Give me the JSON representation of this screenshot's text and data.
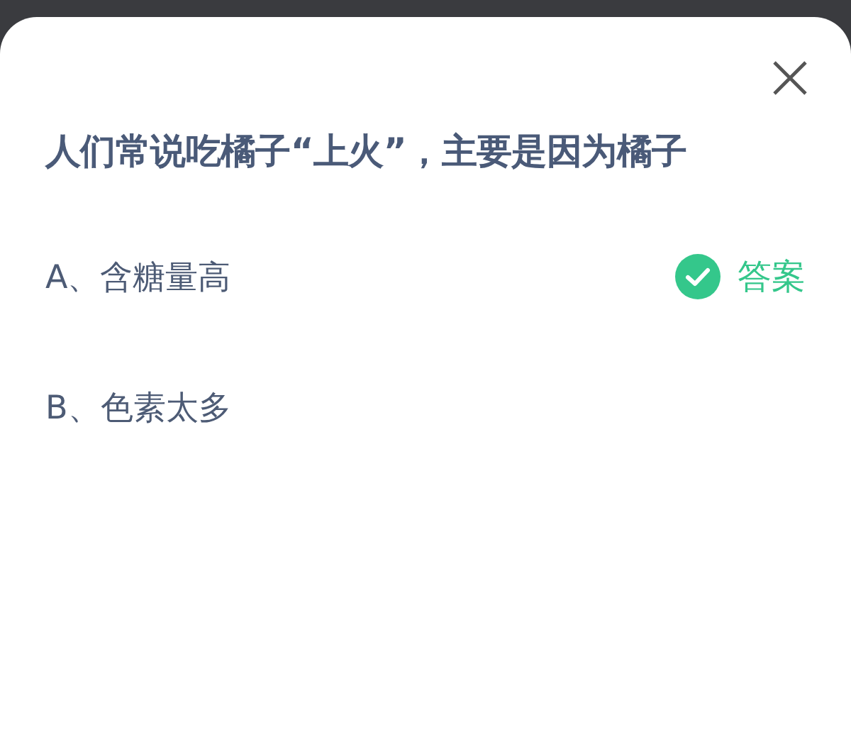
{
  "question": "人们常说吃橘子“上火”，主要是因为橘子",
  "options": [
    {
      "label": "A、含糖量高",
      "correct": true,
      "answer_label": "答案"
    },
    {
      "label": "B、色素太多",
      "correct": false
    }
  ]
}
